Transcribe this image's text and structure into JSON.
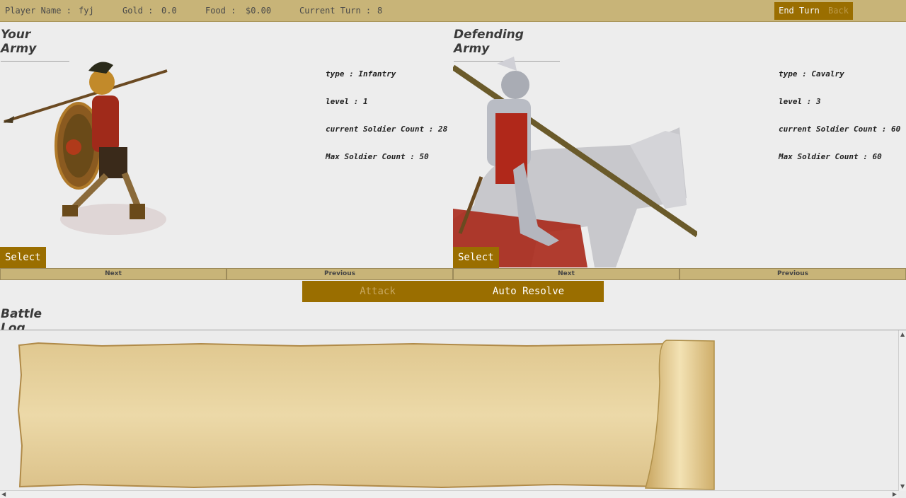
{
  "topbar": {
    "player_label": "Player Name :",
    "player_value": "fyj",
    "gold_label": "Gold :",
    "gold_value": "0.0",
    "food_label": "Food :",
    "food_value": "$0.00",
    "turn_label": "Current Turn :",
    "turn_value": "8",
    "end_turn": "End Turn",
    "back": "Back"
  },
  "your_army": {
    "title": "Your Army",
    "type": "type : Infantry",
    "level": "level : 1",
    "current": "current Soldier Count : 28",
    "max": "Max Soldier Count : 50",
    "select": "Select",
    "next": "Next",
    "previous": "Previous",
    "image_icon": "infantry-soldier-image"
  },
  "defending_army": {
    "title": "Defending Army",
    "type": "type : Cavalry",
    "level": "level : 3",
    "current": "current Soldier Count : 60",
    "max": "Max Soldier Count : 60",
    "select": "Select",
    "next": "Next",
    "previous": "Previous",
    "image_icon": "cavalry-knight-image"
  },
  "actions": {
    "attack": "Attack",
    "auto_resolve": "Auto Resolve"
  },
  "battle_log": {
    "title": "Battle Log"
  },
  "colors": {
    "accent": "#9a6e00",
    "bar": "#c8b478",
    "background": "#ededed"
  }
}
